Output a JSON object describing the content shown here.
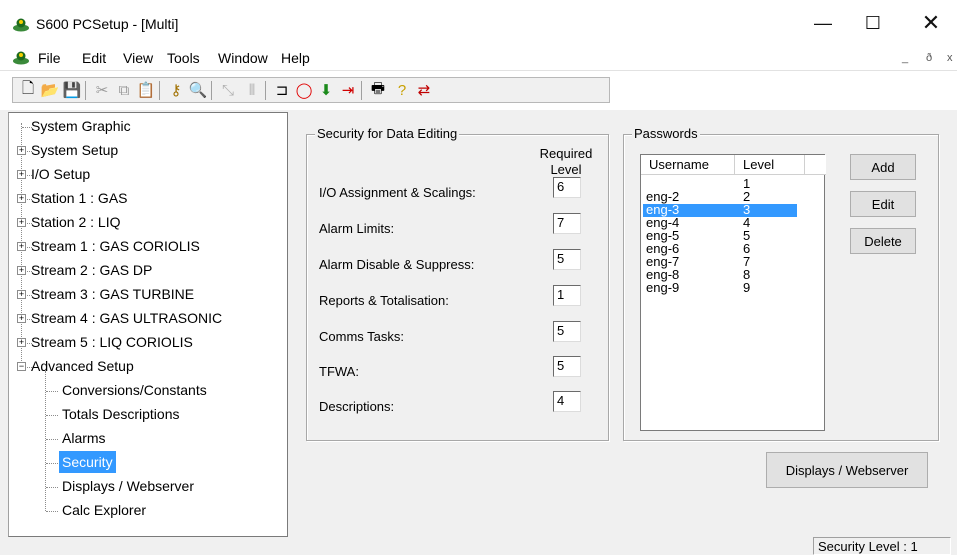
{
  "window": {
    "title": "S600 PCSetup  - [Multi]",
    "minimize_glyph": "—",
    "maximize_glyph": "☐",
    "close_glyph": "✕"
  },
  "menu": {
    "items": [
      "File",
      "Edit",
      "View",
      "Tools",
      "Window",
      "Help"
    ],
    "mdi_controls": [
      "_",
      "ð",
      "x"
    ]
  },
  "toolbar": {
    "buttons": [
      {
        "name": "new-icon",
        "glyph": "🗋",
        "color": "#000000"
      },
      {
        "name": "open-icon",
        "glyph": "📂",
        "color": "#c89b1a"
      },
      {
        "name": "save-icon",
        "glyph": "💾",
        "color": "#000000"
      },
      {
        "name": "cut-icon",
        "glyph": "✂",
        "color": "#9a9a9a"
      },
      {
        "name": "copy-icon",
        "glyph": "⧉",
        "color": "#9a9a9a"
      },
      {
        "name": "paste-icon",
        "glyph": "📋",
        "color": "#9a9a9a"
      },
      {
        "name": "key-icon",
        "glyph": "⚷",
        "color": "#a07000"
      },
      {
        "name": "magnify-key-icon",
        "glyph": "🔍",
        "color": "#2f6b2f"
      },
      {
        "name": "connect-disabled-icon",
        "glyph": "⤡",
        "color": "#b0b0b0"
      },
      {
        "name": "bars-disabled-icon",
        "glyph": "⫴",
        "color": "#b0b0b0"
      },
      {
        "name": "plug-icon",
        "glyph": "⊐",
        "color": "#000000"
      },
      {
        "name": "stop-icon",
        "glyph": "◯",
        "color": "#e00000"
      },
      {
        "name": "download-icon",
        "glyph": "⬇",
        "color": "#1b8a1b"
      },
      {
        "name": "upload-icon",
        "glyph": "⇥",
        "color": "#d00000"
      },
      {
        "name": "print-icon",
        "glyph": "🖶",
        "color": "#000000"
      },
      {
        "name": "help-icon",
        "glyph": "?",
        "color": "#c8a000"
      },
      {
        "name": "swap-icon",
        "glyph": "⇄",
        "color": "#c00000"
      }
    ]
  },
  "tree": {
    "items": [
      {
        "label": "System Graphic",
        "expander": ""
      },
      {
        "label": "System Setup",
        "expander": "+"
      },
      {
        "label": "I/O Setup",
        "expander": "+"
      },
      {
        "label": "Station 1 : GAS",
        "expander": "+"
      },
      {
        "label": "Station 2 : LIQ",
        "expander": "+"
      },
      {
        "label": "Stream 1 : GAS CORIOLIS",
        "expander": "+"
      },
      {
        "label": "Stream 2 : GAS DP",
        "expander": "+"
      },
      {
        "label": "Stream 3 : GAS TURBINE",
        "expander": "+"
      },
      {
        "label": "Stream 4 : GAS ULTRASONIC",
        "expander": "+"
      },
      {
        "label": "Stream 5 : LIQ CORIOLIS",
        "expander": "+"
      },
      {
        "label": "Advanced Setup",
        "expander": "−"
      }
    ],
    "children": [
      {
        "label": "Conversions/Constants",
        "selected": false
      },
      {
        "label": "Totals Descriptions",
        "selected": false
      },
      {
        "label": "Alarms",
        "selected": false
      },
      {
        "label": "Security",
        "selected": true
      },
      {
        "label": "Displays / Webserver",
        "selected": false
      },
      {
        "label": "Calc Explorer",
        "selected": false
      }
    ]
  },
  "security": {
    "group_title": "Security for Data Editing",
    "required_level_header": [
      "Required",
      "Level"
    ],
    "rows": [
      {
        "label": "I/O Assignment & Scalings:",
        "value": "6"
      },
      {
        "label": "Alarm Limits:",
        "value": "7"
      },
      {
        "label": "Alarm Disable & Suppress:",
        "value": "5"
      },
      {
        "label": "Reports & Totalisation:",
        "value": "1"
      },
      {
        "label": "Comms Tasks:",
        "value": "5"
      },
      {
        "label": "TFWA:",
        "value": "5"
      },
      {
        "label": "Descriptions:",
        "value": "4"
      }
    ]
  },
  "passwords": {
    "group_title": "Passwords",
    "columns": [
      "Username",
      "Level"
    ],
    "rows": [
      {
        "username": "",
        "level": "1",
        "selected": false
      },
      {
        "username": "eng-2",
        "level": "2",
        "selected": false
      },
      {
        "username": "eng-3",
        "level": "3",
        "selected": true
      },
      {
        "username": "eng-4",
        "level": "4",
        "selected": false
      },
      {
        "username": "eng-5",
        "level": "5",
        "selected": false
      },
      {
        "username": "eng-6",
        "level": "6",
        "selected": false
      },
      {
        "username": "eng-7",
        "level": "7",
        "selected": false
      },
      {
        "username": "eng-8",
        "level": "8",
        "selected": false
      },
      {
        "username": "eng-9",
        "level": "9",
        "selected": false
      }
    ],
    "buttons": {
      "add": "Add",
      "edit": "Edit",
      "delete": "Delete"
    }
  },
  "displays_button": "Displays / Webserver",
  "status_bar": {
    "security_level": "Security Level : 1"
  },
  "colors": {
    "selection": "#3399ff",
    "panel": "#f0f0f0"
  }
}
